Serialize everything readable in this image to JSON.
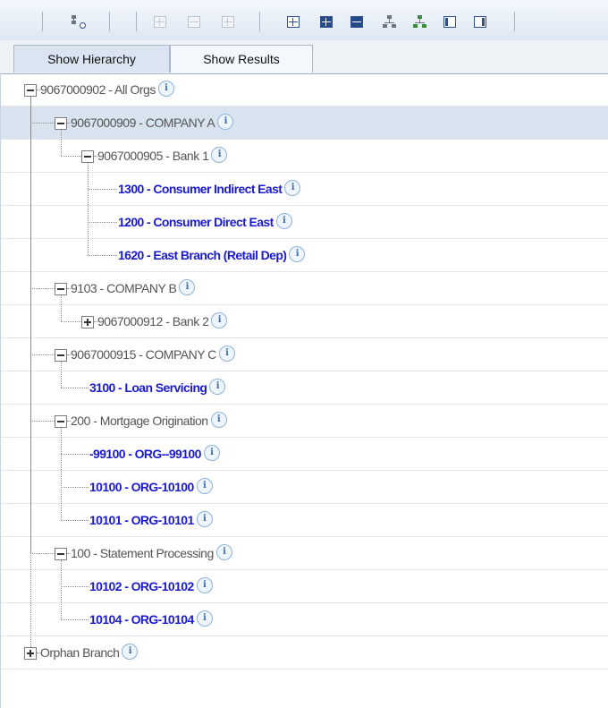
{
  "tabs": [
    {
      "label": "Show Hierarchy",
      "active": true
    },
    {
      "label": "Show Results",
      "active": false
    }
  ],
  "toolbar": {
    "icons": [
      "search-hierarchy-icon",
      "add-node-icon",
      "edit-node-icon",
      "delete-node-icon",
      "expand-all-icon",
      "expand-level-icon",
      "collapse-level-icon",
      "org-chart-icon",
      "tree-layout-icon",
      "column-left-icon",
      "column-right-icon"
    ]
  },
  "info_glyph": "i",
  "tree": [
    {
      "label": "9067000902 - All Orgs",
      "kind": "org",
      "toggle": "minus",
      "level": 0
    },
    {
      "label": "9067000909 - COMPANY A",
      "kind": "org",
      "toggle": "minus",
      "level": 1,
      "selected": true
    },
    {
      "label": "9067000905 - Bank 1",
      "kind": "org",
      "toggle": "minus",
      "level": 2
    },
    {
      "label": "1300 - Consumer Indirect East",
      "kind": "leaf",
      "level": 3
    },
    {
      "label": "1200 - Consumer Direct East",
      "kind": "leaf",
      "level": 3
    },
    {
      "label": "1620 - East Branch  (Retail Dep)",
      "kind": "leaf",
      "level": 3
    },
    {
      "label": "9103 - COMPANY B",
      "kind": "org",
      "toggle": "minus",
      "level": 1
    },
    {
      "label": "9067000912 - Bank 2",
      "kind": "org",
      "toggle": "plus",
      "level": 2
    },
    {
      "label": "9067000915 - COMPANY C",
      "kind": "org",
      "toggle": "minus",
      "level": 1
    },
    {
      "label": "3100 - Loan Servicing",
      "kind": "leaf",
      "level": 2
    },
    {
      "label": "200 - Mortgage Origination",
      "kind": "org",
      "toggle": "minus",
      "level": 1
    },
    {
      "label": "-99100 - ORG--99100",
      "kind": "leaf",
      "level": 2
    },
    {
      "label": "10100 - ORG-10100",
      "kind": "leaf",
      "level": 2
    },
    {
      "label": "10101 - ORG-10101",
      "kind": "leaf",
      "level": 2
    },
    {
      "label": "100 - Statement Processing",
      "kind": "org",
      "toggle": "minus",
      "level": 1
    },
    {
      "label": "10102 - ORG-10102",
      "kind": "leaf",
      "level": 2
    },
    {
      "label": "10104 - ORG-10104",
      "kind": "leaf",
      "level": 2
    },
    {
      "label": "Orphan Branch",
      "kind": "org",
      "toggle": "plus",
      "level": 0
    }
  ]
}
